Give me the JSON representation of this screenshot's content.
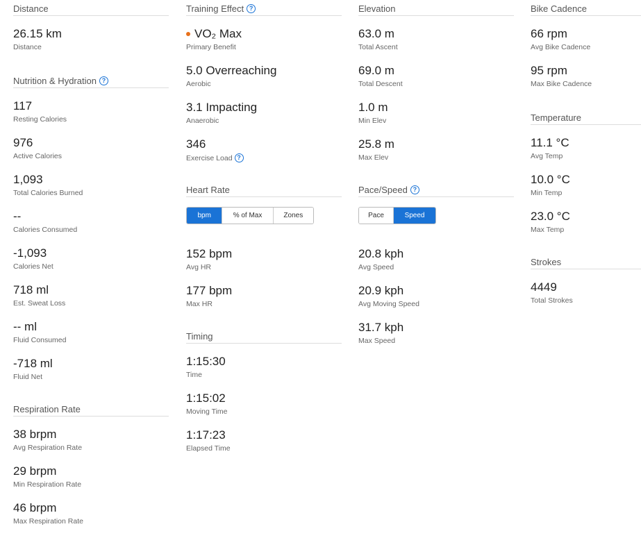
{
  "help_glyph": "?",
  "col1": {
    "distance": {
      "title": "Distance",
      "stats": [
        {
          "value": "26.15 km",
          "label": "Distance"
        }
      ]
    },
    "nutrition": {
      "title": "Nutrition & Hydration",
      "stats": [
        {
          "value": "117",
          "label": "Resting Calories"
        },
        {
          "value": "976",
          "label": "Active Calories"
        },
        {
          "value": "1,093",
          "label": "Total Calories Burned"
        },
        {
          "value": "--",
          "label": "Calories Consumed"
        },
        {
          "value": "-1,093",
          "label": "Calories Net"
        },
        {
          "value": "718 ml",
          "label": "Est. Sweat Loss"
        },
        {
          "value": "-- ml",
          "label": "Fluid Consumed"
        },
        {
          "value": "-718 ml",
          "label": "Fluid Net"
        }
      ]
    },
    "respiration": {
      "title": "Respiration Rate",
      "stats": [
        {
          "value": "38 brpm",
          "label": "Avg Respiration Rate"
        },
        {
          "value": "29 brpm",
          "label": "Min Respiration Rate"
        },
        {
          "value": "46 brpm",
          "label": "Max Respiration Rate"
        }
      ]
    }
  },
  "col2": {
    "training": {
      "title": "Training Effect",
      "stats": [
        {
          "value": "VO₂ Max",
          "label": "Primary Benefit",
          "dot_color": "#e8701a"
        },
        {
          "value": "5.0 Overreaching",
          "label": "Aerobic"
        },
        {
          "value": "3.1 Impacting",
          "label": "Anaerobic"
        },
        {
          "value": "346",
          "label": "Exercise Load"
        }
      ]
    },
    "heart_rate": {
      "title": "Heart Rate",
      "toggle": [
        "bpm",
        "% of Max",
        "Zones"
      ],
      "active": "bpm",
      "stats": [
        {
          "value": "152 bpm",
          "label": "Avg HR"
        },
        {
          "value": "177 bpm",
          "label": "Max HR"
        }
      ]
    },
    "timing": {
      "title": "Timing",
      "stats": [
        {
          "value": "1:15:30",
          "label": "Time"
        },
        {
          "value": "1:15:02",
          "label": "Moving Time"
        },
        {
          "value": "1:17:23",
          "label": "Elapsed Time"
        }
      ]
    }
  },
  "col3": {
    "elevation": {
      "title": "Elevation",
      "stats": [
        {
          "value": "63.0 m",
          "label": "Total Ascent"
        },
        {
          "value": "69.0 m",
          "label": "Total Descent"
        },
        {
          "value": "1.0 m",
          "label": "Min Elev"
        },
        {
          "value": "25.8 m",
          "label": "Max Elev"
        }
      ]
    },
    "pace_speed": {
      "title": "Pace/Speed",
      "toggle": [
        "Pace",
        "Speed"
      ],
      "active": "Speed",
      "stats": [
        {
          "value": "20.8 kph",
          "label": "Avg Speed"
        },
        {
          "value": "20.9 kph",
          "label": "Avg Moving Speed"
        },
        {
          "value": "31.7 kph",
          "label": "Max Speed"
        }
      ]
    }
  },
  "col4": {
    "cadence": {
      "title": "Bike Cadence",
      "stats": [
        {
          "value": "66 rpm",
          "label": "Avg Bike Cadence"
        },
        {
          "value": "95 rpm",
          "label": "Max Bike Cadence"
        }
      ]
    },
    "temperature": {
      "title": "Temperature",
      "stats": [
        {
          "value": "11.1 °C",
          "label": "Avg Temp"
        },
        {
          "value": "10.0 °C",
          "label": "Min Temp"
        },
        {
          "value": "23.0 °C",
          "label": "Max Temp"
        }
      ]
    },
    "strokes": {
      "title": "Strokes",
      "stats": [
        {
          "value": "4449",
          "label": "Total Strokes"
        }
      ]
    }
  }
}
